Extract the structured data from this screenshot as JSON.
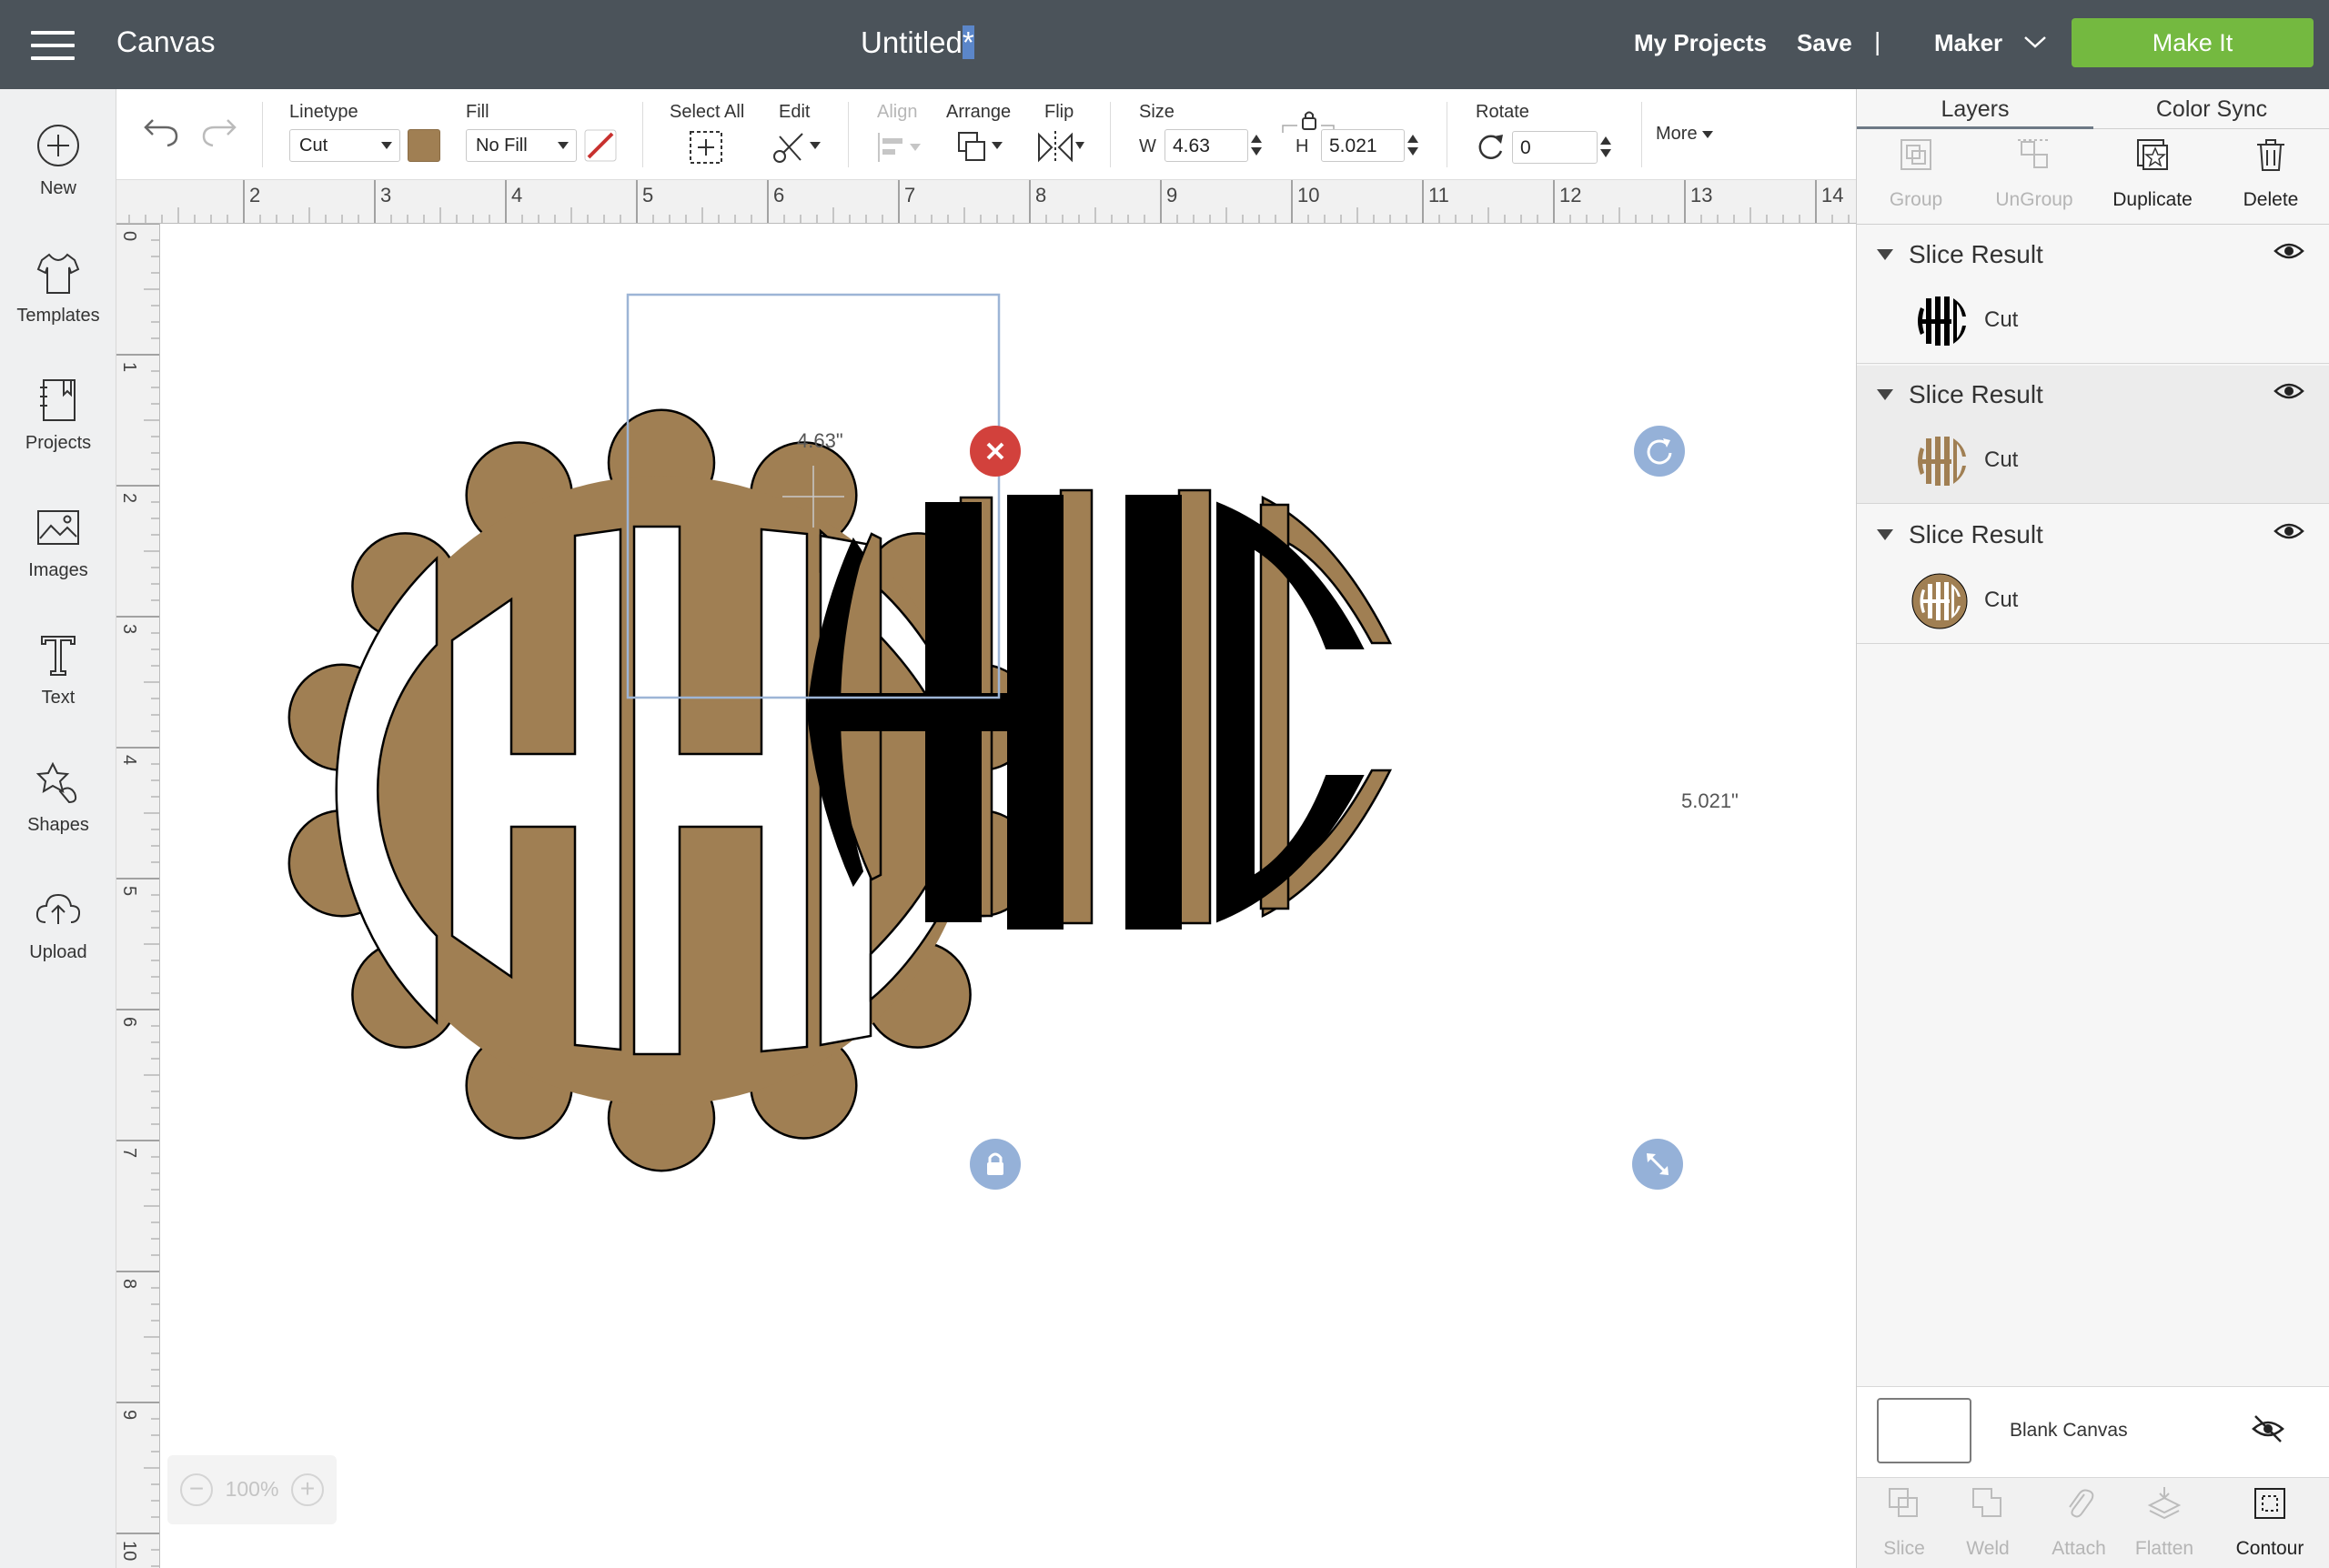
{
  "header": {
    "app_title": "Canvas",
    "doc_title": "Untitled",
    "doc_title_unsaved_mark": "*",
    "my_projects": "My Projects",
    "save": "Save",
    "separator": "|",
    "machine": "Maker",
    "make_it": "Make It"
  },
  "left_tools": [
    {
      "label": "New",
      "icon": "plus-circle-icon"
    },
    {
      "label": "Templates",
      "icon": "tshirt-icon"
    },
    {
      "label": "Projects",
      "icon": "notebook-icon"
    },
    {
      "label": "Images",
      "icon": "image-icon"
    },
    {
      "label": "Text",
      "icon": "text-t-icon"
    },
    {
      "label": "Shapes",
      "icon": "shapes-icon"
    },
    {
      "label": "Upload",
      "icon": "cloud-upload-icon"
    }
  ],
  "toolbar": {
    "linetype_label": "Linetype",
    "linetype_value": "Cut",
    "linetype_color": "#a07f53",
    "fill_label": "Fill",
    "fill_value": "No Fill",
    "select_all_label": "Select All",
    "edit_label": "Edit",
    "align_label": "Align",
    "arrange_label": "Arrange",
    "flip_label": "Flip",
    "size_label": "Size",
    "w_label": "W",
    "w_value": "4.63",
    "h_label": "H",
    "h_value": "5.021",
    "rotate_label": "Rotate",
    "rotate_value": "0",
    "more_label": "More"
  },
  "ruler": {
    "h_ticks": [
      "2",
      "3",
      "4",
      "5",
      "6",
      "7",
      "8",
      "9",
      "10",
      "11",
      "12",
      "13",
      "14"
    ],
    "v_ticks": [
      "0",
      "1",
      "2",
      "3",
      "4",
      "5",
      "6",
      "7",
      "8",
      "9",
      "10"
    ]
  },
  "canvas": {
    "width_label": "4.63\"",
    "height_label": "5.021\"",
    "monogram_letters": "HHC",
    "zoom_value": "100%",
    "zoom_minus": "−",
    "zoom_plus": "+"
  },
  "right_panel": {
    "tabs": [
      "Layers",
      "Color Sync"
    ],
    "actions": [
      "Group",
      "UnGroup",
      "Duplicate",
      "Delete"
    ],
    "layers": [
      {
        "name": "Slice Result",
        "operation": "Cut",
        "thumb_color": "#000000"
      },
      {
        "name": "Slice Result",
        "operation": "Cut",
        "thumb_color": "#a07f53"
      },
      {
        "name": "Slice Result",
        "operation": "Cut",
        "thumb_color": "#a07f53"
      }
    ],
    "blank_canvas_label": "Blank Canvas",
    "bottom_actions": [
      "Slice",
      "Weld",
      "Attach",
      "Flatten",
      "Contour"
    ]
  },
  "colors": {
    "topbar": "#4b535a",
    "make_it": "#74b940",
    "brown": "#a07f53",
    "selection": "#9db5d6",
    "delete_handle": "#d2413c",
    "handle_blue": "#95b1d8"
  }
}
